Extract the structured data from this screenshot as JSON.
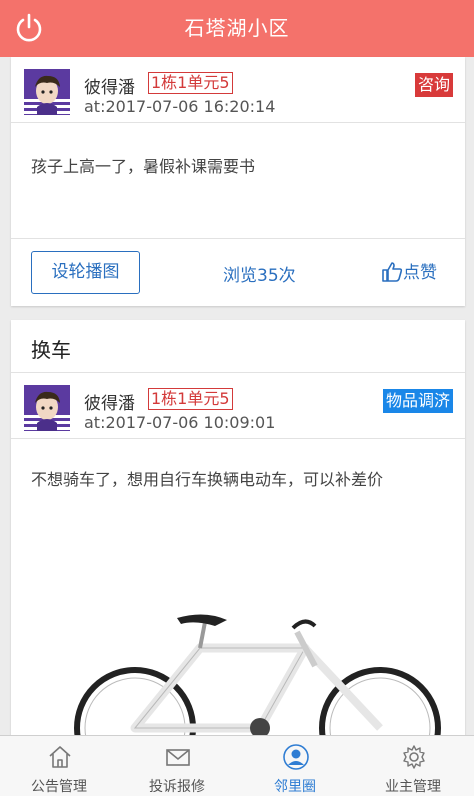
{
  "header": {
    "title": "石塔湖小区",
    "power_icon": "power-icon"
  },
  "posts": [
    {
      "user": "彼得潘",
      "unit": "1栋1单元5",
      "time": "at:2017-07-06 16:20:14",
      "tag": "咨询",
      "tag_color": "#d83a3a",
      "content": "孩子上高一了，暑假补课需要书",
      "actions": {
        "carousel_label": "设轮播图",
        "views": "浏览35次",
        "like_label": "点赞"
      }
    },
    {
      "title": "换车",
      "user": "彼得潘",
      "unit": "1栋1单元5",
      "time": "at:2017-07-06 10:09:01",
      "tag": "物品调济",
      "tag_color": "#1a87e8",
      "content": "不想骑车了，想用自行车换辆电动车，可以补差价"
    }
  ],
  "tabs": [
    {
      "label": "公告管理",
      "icon": "home-icon"
    },
    {
      "label": "投诉报修",
      "icon": "mail-icon"
    },
    {
      "label": "邻里圈",
      "icon": "user-icon",
      "active": true
    },
    {
      "label": "业主管理",
      "icon": "gear-icon"
    }
  ],
  "colors": {
    "header": "#f4726b",
    "accent": "#2a6fbf",
    "tab_active": "#2f7dd3"
  }
}
